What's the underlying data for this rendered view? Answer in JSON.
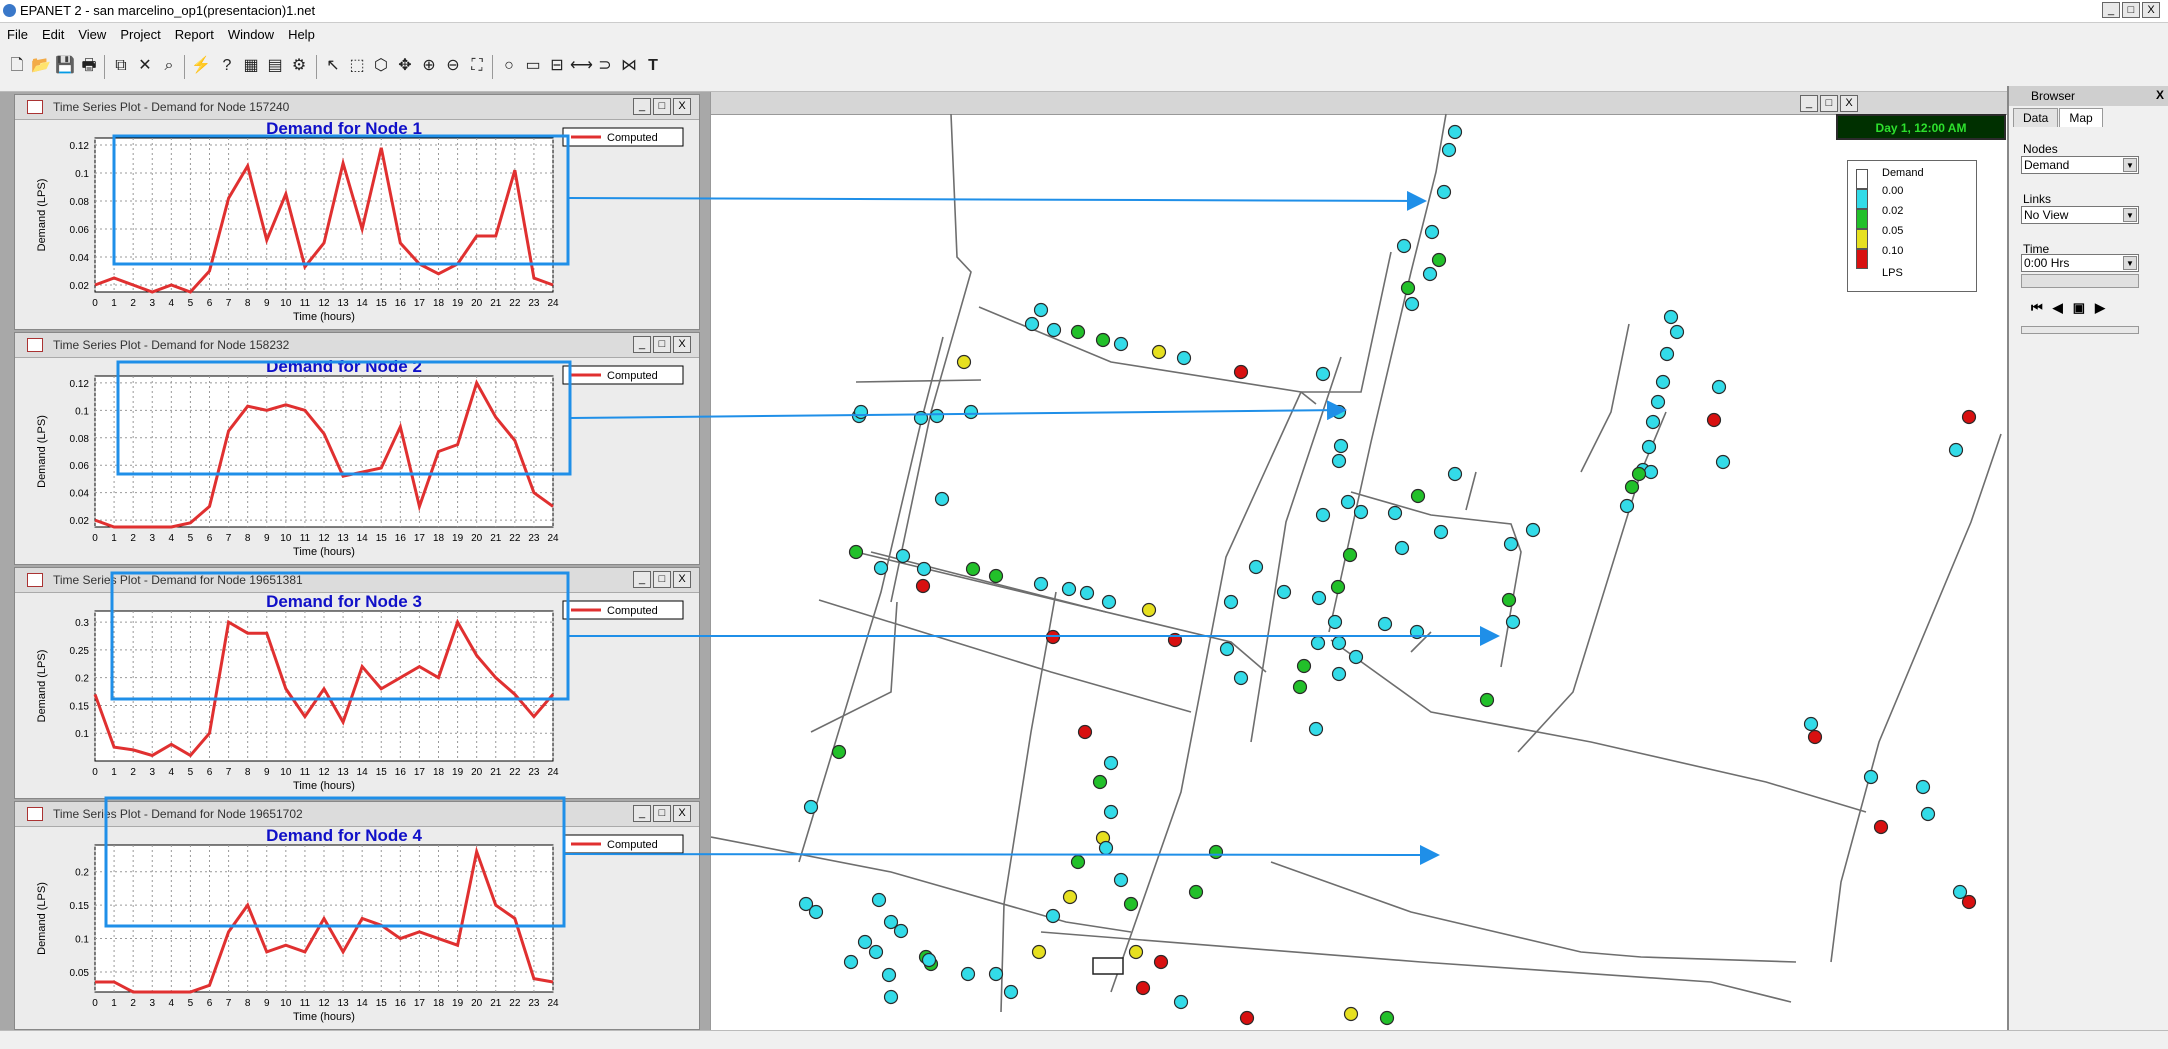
{
  "app": {
    "title": "EPANET 2 - san marcelino_op1(presentacion)1.net",
    "window_buttons": [
      "_",
      "□",
      "X"
    ]
  },
  "menu": [
    "File",
    "Edit",
    "View",
    "Project",
    "Report",
    "Window",
    "Help"
  ],
  "toolbar": {
    "icons": [
      "new-file-icon",
      "open-folder-icon",
      "save-icon",
      "print-icon",
      "copy-icon",
      "delete-icon",
      "find-icon",
      "run-icon",
      "query-icon",
      "graph-icon",
      "table-icon",
      "options-icon",
      "select-object-icon",
      "select-vertex-icon",
      "select-region-icon",
      "pan-icon",
      "zoom-in-icon",
      "zoom-out-icon",
      "full-extent-icon",
      "add-junction-icon",
      "add-reservoir-icon",
      "add-tank-icon",
      "add-pipe-icon",
      "add-pump-icon",
      "add-valve-icon",
      "add-label-icon"
    ]
  },
  "plots": [
    {
      "window_title": "Time Series Plot - Demand for Node 157240",
      "chart_title": "Demand for Node 1",
      "legend": "Computed",
      "ylabel": "Demand (LPS)",
      "xlabel": "Time (hours)",
      "ylim": [
        0.015,
        0.125
      ],
      "yticks": [
        "0.02",
        "0.04",
        "0.06",
        "0.08",
        "0.1",
        "0.12"
      ],
      "ytick_values": [
        0.02,
        0.04,
        0.06,
        0.08,
        0.1,
        0.12
      ],
      "xticks": [
        "0",
        "1",
        "2",
        "3",
        "4",
        "5",
        "6",
        "7",
        "8",
        "9",
        "10",
        "11",
        "12",
        "13",
        "14",
        "15",
        "16",
        "17",
        "18",
        "19",
        "20",
        "21",
        "22",
        "23",
        "24"
      ],
      "values": [
        0.02,
        0.025,
        0.02,
        0.015,
        0.02,
        0.015,
        0.03,
        0.082,
        0.105,
        0.052,
        0.085,
        0.033,
        0.05,
        0.107,
        0.06,
        0.118,
        0.05,
        0.035,
        0.028,
        0.035,
        0.055,
        0.055,
        0.102,
        0.025,
        0.02
      ]
    },
    {
      "window_title": "Time Series Plot - Demand for Node 158232",
      "chart_title": "Demand for Node 2",
      "legend": "Computed",
      "ylabel": "Demand (LPS)",
      "xlabel": "Time (hours)",
      "ylim": [
        0.015,
        0.125
      ],
      "yticks": [
        "0.02",
        "0.04",
        "0.06",
        "0.08",
        "0.1",
        "0.12"
      ],
      "ytick_values": [
        0.02,
        0.04,
        0.06,
        0.08,
        0.1,
        0.12
      ],
      "xticks": [
        "0",
        "1",
        "2",
        "3",
        "4",
        "5",
        "6",
        "7",
        "8",
        "9",
        "10",
        "11",
        "12",
        "13",
        "14",
        "15",
        "16",
        "17",
        "18",
        "19",
        "20",
        "21",
        "22",
        "23",
        "24"
      ],
      "values": [
        0.02,
        0.015,
        0.015,
        0.015,
        0.015,
        0.018,
        0.03,
        0.085,
        0.103,
        0.1,
        0.104,
        0.1,
        0.083,
        0.052,
        0.055,
        0.058,
        0.088,
        0.03,
        0.07,
        0.075,
        0.12,
        0.095,
        0.078,
        0.04,
        0.03
      ]
    },
    {
      "window_title": "Time Series Plot - Demand for Node 19651381",
      "chart_title": "Demand for Node 3",
      "legend": "Computed",
      "ylabel": "Demand (LPS)",
      "xlabel": "Time (hours)",
      "ylim": [
        0.05,
        0.32
      ],
      "yticks": [
        "0.1",
        "0.15",
        "0.2",
        "0.25",
        "0.3"
      ],
      "ytick_values": [
        0.1,
        0.15,
        0.2,
        0.25,
        0.3
      ],
      "xticks": [
        "0",
        "1",
        "2",
        "3",
        "4",
        "5",
        "6",
        "7",
        "8",
        "9",
        "10",
        "11",
        "12",
        "13",
        "14",
        "15",
        "16",
        "17",
        "18",
        "19",
        "20",
        "21",
        "22",
        "23",
        "24"
      ],
      "values": [
        0.17,
        0.075,
        0.07,
        0.06,
        0.08,
        0.06,
        0.1,
        0.3,
        0.28,
        0.28,
        0.18,
        0.13,
        0.18,
        0.12,
        0.22,
        0.18,
        0.2,
        0.22,
        0.2,
        0.3,
        0.24,
        0.2,
        0.17,
        0.13,
        0.17
      ]
    },
    {
      "window_title": "Time Series Plot - Demand for Node 19651702",
      "chart_title": "Demand for Node 4",
      "legend": "Computed",
      "ylabel": "Demand (LPS)",
      "xlabel": "Time (hours)",
      "ylim": [
        0.02,
        0.24
      ],
      "yticks": [
        "0.05",
        "0.1",
        "0.15",
        "0.2"
      ],
      "ytick_values": [
        0.05,
        0.1,
        0.15,
        0.2
      ],
      "xticks": [
        "0",
        "1",
        "2",
        "3",
        "4",
        "5",
        "6",
        "7",
        "8",
        "9",
        "10",
        "11",
        "12",
        "13",
        "14",
        "15",
        "16",
        "17",
        "18",
        "19",
        "20",
        "21",
        "22",
        "23",
        "24"
      ],
      "values": [
        0.035,
        0.035,
        0.02,
        0.02,
        0.02,
        0.02,
        0.03,
        0.11,
        0.15,
        0.08,
        0.09,
        0.08,
        0.13,
        0.08,
        0.13,
        0.12,
        0.1,
        0.11,
        0.1,
        0.09,
        0.23,
        0.15,
        0.13,
        0.04,
        0.035
      ]
    }
  ],
  "map": {
    "time_label": "Day 1, 12:00 AM",
    "legend": {
      "title": "Demand",
      "values": [
        "0.00",
        "0.02",
        "0.05",
        "0.10"
      ],
      "unit": "LPS",
      "colors": [
        "#ffffff",
        "#33dbe8",
        "#22c02a",
        "#e6e020",
        "#d81010"
      ]
    }
  },
  "browser": {
    "title": "Browser",
    "tabs": [
      "Data",
      "Map"
    ],
    "active_tab": "Map",
    "nodes_label": "Nodes",
    "nodes_value": "Demand",
    "links_label": "Links",
    "links_value": "No View",
    "time_label": "Time",
    "time_value": "0:00 Hrs",
    "playback_icons": [
      "rewind-icon",
      "step-back-icon",
      "stop-icon",
      "play-forward-icon"
    ]
  },
  "colors": {
    "series": "#e03030",
    "chart_title": "#1010c8",
    "annotation": "#1f8fe8",
    "junction": "#33dbe8"
  }
}
